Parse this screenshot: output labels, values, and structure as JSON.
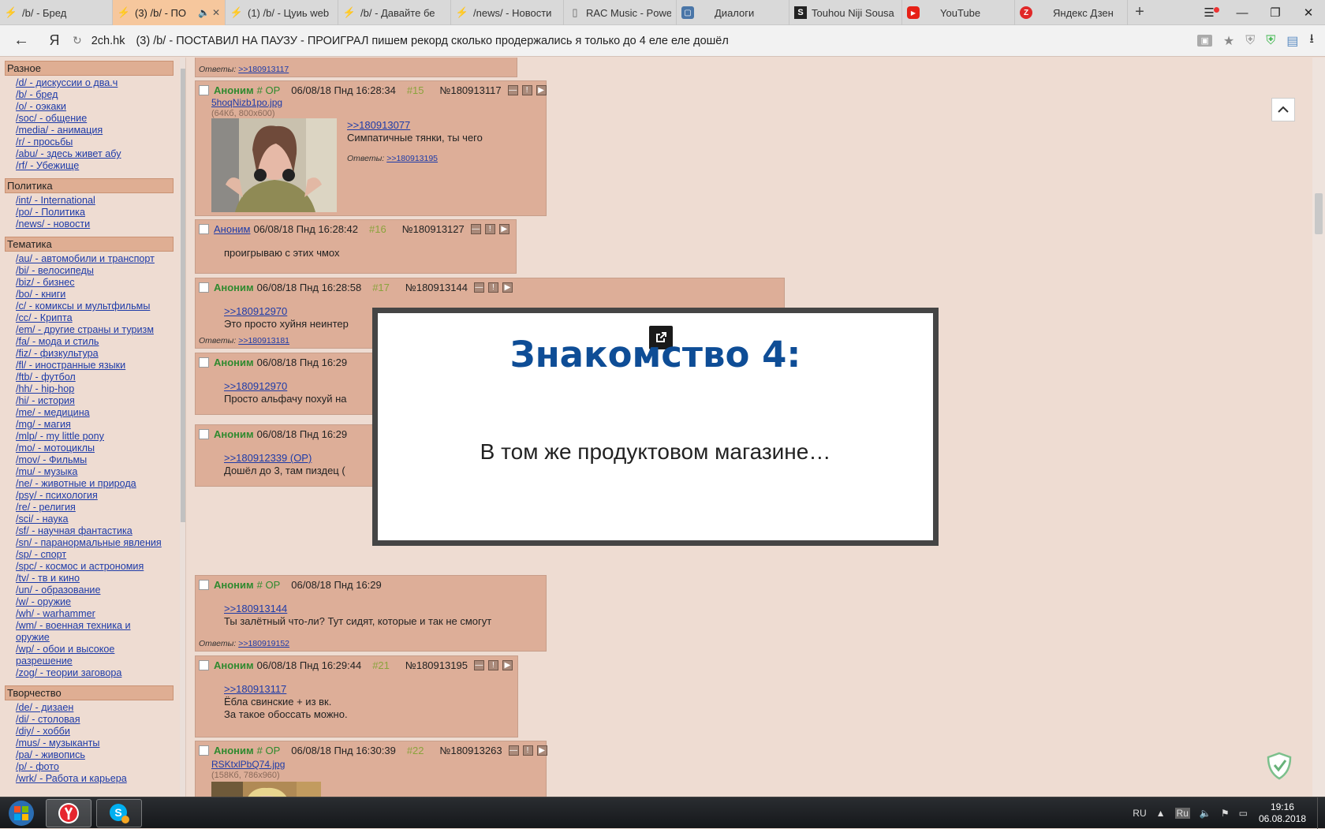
{
  "tabs": [
    {
      "title": "/b/ - Бред",
      "icon": "lightning-icon",
      "active": false
    },
    {
      "title": "(3) /b/ - ПО",
      "icon": "lightning-icon",
      "active": true
    },
    {
      "title": "(1) /b/ - Цуиь web",
      "icon": "lightning-icon",
      "active": false
    },
    {
      "title": "/b/ - Давайте бе",
      "icon": "lightning-icon",
      "active": false
    },
    {
      "title": "/news/ - Новости",
      "icon": "lightning-icon",
      "active": false
    },
    {
      "title": "RAC Music - Powe",
      "icon": "document-icon",
      "active": false
    },
    {
      "title": "Диалоги",
      "icon": "vk-icon",
      "active": false
    },
    {
      "title": "Touhou Niji Sousa",
      "icon": "s-logo-icon",
      "active": false
    },
    {
      "title": "YouTube",
      "icon": "youtube-icon",
      "active": false
    },
    {
      "title": "Яндекс Дзен",
      "icon": "zen-icon",
      "active": false
    }
  ],
  "tab_close": "✕",
  "new_tab": "+",
  "address": {
    "domain": "2ch.hk",
    "title": "(3) /b/ - ПОСТАВИЛ НА ПАУЗУ - ПРОИГРАЛ пишем рекорд сколько продержались я только до 4 еле еле дошёл",
    "back": "←",
    "logo": "Я"
  },
  "sidebar": [
    {
      "title": "Разное",
      "items": [
        "/d/ - дискуссии о два.ч",
        "/b/ - бред",
        "/o/ - оэкаки",
        "/soc/ - общение",
        "/media/ - анимация",
        "/r/ - просьбы",
        "/abu/ - здесь живет абу",
        "/rf/ - Убежище"
      ]
    },
    {
      "title": "Политика",
      "items": [
        "/int/ - International",
        "/po/ - Политика",
        "/news/ - новости"
      ]
    },
    {
      "title": "Тематика",
      "items": [
        "/au/ - автомобили и транспорт",
        "/bi/ - велосипеды",
        "/biz/ - бизнес",
        "/bo/ - книги",
        "/c/ - комиксы и мультфильмы",
        "/cc/ - Крипта",
        "/em/ - другие страны и туризм",
        "/fa/ - мода и стиль",
        "/fiz/ - физкультура",
        "/fl/ - иностранные языки",
        "/ftb/ - футбол",
        "/hh/ - hip-hop",
        "/hi/ - история",
        "/me/ - медицина",
        "/mg/ - магия",
        "/mlp/ - my little pony",
        "/mo/ - мотоциклы",
        "/mov/ - Фильмы",
        "/mu/ - музыка",
        "/ne/ - животные и природа",
        "/psy/ - психология",
        "/re/ - религия",
        "/sci/ - наука",
        "/sf/ - научная фантастика",
        "/sn/ - паранормальные явления",
        "/sp/ - спорт",
        "/spc/ - космос и астрономия",
        "/tv/ - тв и кино",
        "/un/ - образование",
        "/w/ - оружие",
        "/wh/ - warhammer",
        "/wm/ - военная техника и",
        "оружие",
        "/wp/ - обои и высокое",
        "разрешение",
        "/zog/ - теории заговора"
      ]
    },
    {
      "title": "Творчество",
      "items": [
        "/de/ - дизаен",
        "/di/ - столовая",
        "/diy/ - хобби",
        "/mus/ - музыканты",
        "/pa/ - живопись",
        "/p/ - фото",
        "/wrk/ - Работа и карьера"
      ]
    }
  ],
  "posts": [
    {
      "kind": "tail",
      "replies_label": "Ответы:",
      "replies": [
        ">>180913117"
      ]
    },
    {
      "name": "Аноним",
      "op": "# OP",
      "date": "06/08/18 Пнд 16:28:34",
      "num": "#15",
      "id": "№180913117",
      "file": "5hoqNizb1po.jpg",
      "file_meta": "(64Кб, 800x600)",
      "lines": [
        ">>180913077",
        "Симпатичные тянки, ты чего"
      ],
      "replies_label": "Ответы:",
      "replies": [
        ">>180913195"
      ]
    },
    {
      "name": "Аноним",
      "date": "06/08/18 Пнд 16:28:42",
      "num": "#16",
      "id": "№180913127",
      "lines": [
        "проигрываю с этих чмох"
      ]
    },
    {
      "name": "Аноним",
      "date": "06/08/18 Пнд 16:28:58",
      "num": "#17",
      "id": "№180913144",
      "lines": [
        ">>180912970",
        "Это просто хуйня неинтер"
      ],
      "replies_label": "Ответы:",
      "replies": [
        ">>180913181"
      ]
    },
    {
      "name": "Аноним",
      "date": "06/08/18 Пнд 16:29",
      "lines": [
        ">>180912970",
        "Просто альфачу похуй на"
      ]
    },
    {
      "name": "Аноним",
      "date": "06/08/18 Пнд 16:29",
      "lines": [
        ">>180912339 (OP)",
        "Дошёл до 3, там пиздец ("
      ]
    },
    {
      "name": "Аноним",
      "op": "# OP",
      "date": "06/08/18 Пнд 16:29",
      "lines": [
        ">>180913144",
        "Ты залётный что-ли? Тут сидят, которые и так не смогут"
      ],
      "replies_label": "Ответы:",
      "replies": [
        ">>180919152"
      ]
    },
    {
      "name": "Аноним",
      "date": "06/08/18 Пнд 16:29:44",
      "num": "#21",
      "id": "№180913195",
      "lines": [
        ">>180913117",
        "Ёбла свинские + из вк.",
        "За такое обоссать можно."
      ]
    },
    {
      "name": "Аноним",
      "op": "# OP",
      "date": "06/08/18 Пнд 16:30:39",
      "num": "#22",
      "id": "№180913263",
      "file": "RSKtxlPbQ74.jpg",
      "file_meta": "(158Кб, 786x960)"
    }
  ],
  "popup": {
    "title": "Знакомство 4:",
    "text": "В том же продуктовом магазине…"
  },
  "taskbar": {
    "lang": "RU",
    "tray_lang": "Ru",
    "time": "19:16",
    "date": "06.08.2018"
  },
  "colors": {
    "board_bg": "#eedcd2",
    "post_bg": "#ddae98",
    "link": "#1e3ba8",
    "name_green": "#2f8a2f",
    "popup_title": "#0e4d96",
    "active_tab": "#f6c79d"
  }
}
